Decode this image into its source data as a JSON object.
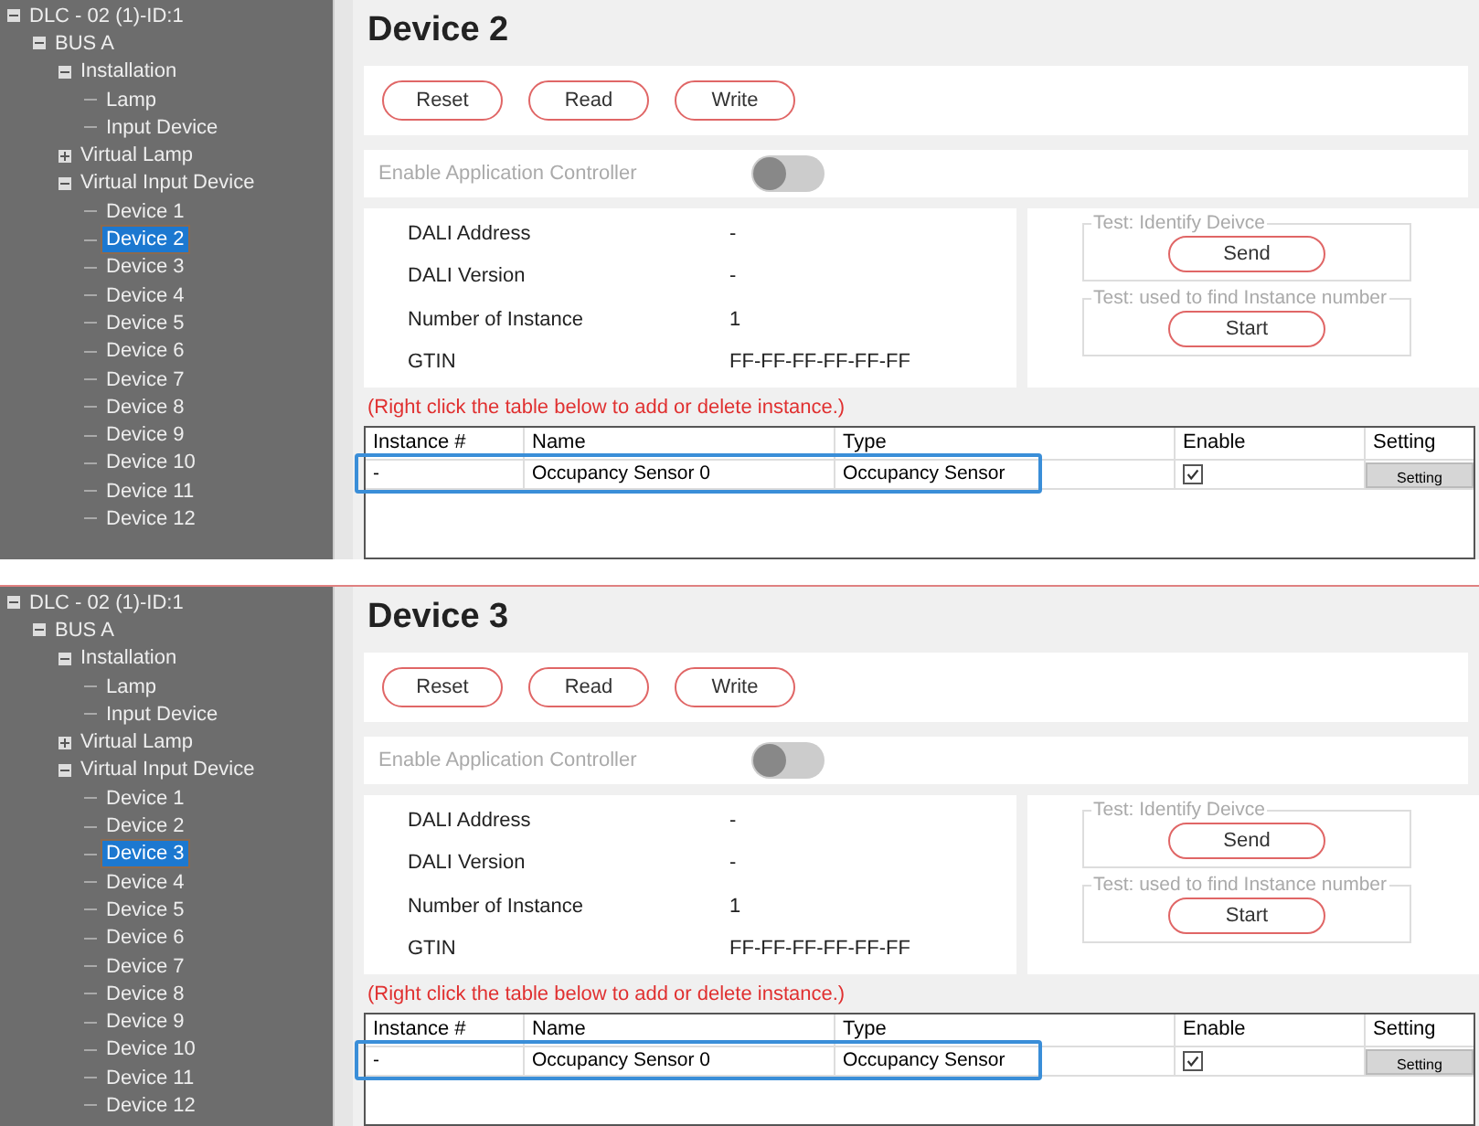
{
  "panels": [
    {
      "tree": [
        {
          "label": "DLC - 02 (1)-ID:1",
          "expanded": true,
          "selected": false,
          "children": [
            {
              "label": "BUS A",
              "expanded": true,
              "selected": false,
              "children": [
                {
                  "label": "Installation",
                  "expanded": true,
                  "selected": false,
                  "children": [
                    {
                      "label": "Lamp",
                      "selected": false
                    },
                    {
                      "label": "Input Device",
                      "selected": false
                    }
                  ]
                },
                {
                  "label": "Virtual Lamp",
                  "expanded": false,
                  "selected": false
                },
                {
                  "label": "Virtual Input Device",
                  "expanded": true,
                  "selected": false,
                  "children": [
                    {
                      "label": "Device 1",
                      "selected": false
                    },
                    {
                      "label": "Device 2",
                      "selected": true
                    },
                    {
                      "label": "Device 3",
                      "selected": false
                    },
                    {
                      "label": "Device 4",
                      "selected": false
                    },
                    {
                      "label": "Device 5",
                      "selected": false
                    },
                    {
                      "label": "Device 6",
                      "selected": false
                    },
                    {
                      "label": "Device 7",
                      "selected": false
                    },
                    {
                      "label": "Device 8",
                      "selected": false
                    },
                    {
                      "label": "Device 9",
                      "selected": false
                    },
                    {
                      "label": "Device 10",
                      "selected": false
                    },
                    {
                      "label": "Device 11",
                      "selected": false
                    },
                    {
                      "label": "Device 12",
                      "selected": false
                    }
                  ]
                }
              ]
            }
          ]
        }
      ],
      "title": "Device 2",
      "buttons": [
        "Reset",
        "Read",
        "Write"
      ],
      "enable_controller": {
        "label": "Enable Application Controller",
        "on": false
      },
      "info": [
        {
          "label": "DALI Address",
          "value": "-"
        },
        {
          "label": "DALI Version",
          "value": "-"
        },
        {
          "label": "Number of Instance",
          "value": "1"
        },
        {
          "label": "GTIN",
          "value": "FF-FF-FF-FF-FF-FF"
        }
      ],
      "tests": [
        {
          "legend": "Test: Identify Deivce",
          "button": "Send"
        },
        {
          "legend": "Test: used to find Instance number",
          "button": "Start"
        }
      ],
      "note": "(Right click the table below to add or delete instance.)",
      "table": {
        "columns": [
          "Instance #",
          "Name",
          "Type",
          "Enable",
          "Setting"
        ],
        "rows": [
          {
            "instance": "-",
            "name": "Occupancy Sensor 0",
            "type": "Occupancy Sensor",
            "enabled": true,
            "setting": "Setting",
            "highlighted": true
          }
        ]
      }
    },
    {
      "tree": [
        {
          "label": "DLC - 02 (1)-ID:1",
          "expanded": true,
          "selected": false,
          "children": [
            {
              "label": "BUS A",
              "expanded": true,
              "selected": false,
              "children": [
                {
                  "label": "Installation",
                  "expanded": true,
                  "selected": false,
                  "children": [
                    {
                      "label": "Lamp",
                      "selected": false
                    },
                    {
                      "label": "Input Device",
                      "selected": false
                    }
                  ]
                },
                {
                  "label": "Virtual Lamp",
                  "expanded": false,
                  "selected": false
                },
                {
                  "label": "Virtual Input Device",
                  "expanded": true,
                  "selected": false,
                  "children": [
                    {
                      "label": "Device 1",
                      "selected": false
                    },
                    {
                      "label": "Device 2",
                      "selected": false
                    },
                    {
                      "label": "Device 3",
                      "selected": true
                    },
                    {
                      "label": "Device 4",
                      "selected": false
                    },
                    {
                      "label": "Device 5",
                      "selected": false
                    },
                    {
                      "label": "Device 6",
                      "selected": false
                    },
                    {
                      "label": "Device 7",
                      "selected": false
                    },
                    {
                      "label": "Device 8",
                      "selected": false
                    },
                    {
                      "label": "Device 9",
                      "selected": false
                    },
                    {
                      "label": "Device 10",
                      "selected": false
                    },
                    {
                      "label": "Device 11",
                      "selected": false
                    },
                    {
                      "label": "Device 12",
                      "selected": false
                    }
                  ]
                }
              ]
            }
          ]
        }
      ],
      "title": "Device 3",
      "buttons": [
        "Reset",
        "Read",
        "Write"
      ],
      "enable_controller": {
        "label": "Enable Application Controller",
        "on": false
      },
      "info": [
        {
          "label": "DALI Address",
          "value": "-"
        },
        {
          "label": "DALI Version",
          "value": "-"
        },
        {
          "label": "Number of Instance",
          "value": "1"
        },
        {
          "label": "GTIN",
          "value": "FF-FF-FF-FF-FF-FF"
        }
      ],
      "tests": [
        {
          "legend": "Test: Identify Deivce",
          "button": "Send"
        },
        {
          "legend": "Test: used to find Instance number",
          "button": "Start"
        }
      ],
      "note": "(Right click the table below to add or delete instance.)",
      "table": {
        "columns": [
          "Instance #",
          "Name",
          "Type",
          "Enable",
          "Setting"
        ],
        "rows": [
          {
            "instance": "-",
            "name": "Occupancy Sensor 0",
            "type": "Occupancy Sensor",
            "enabled": true,
            "setting": "Setting",
            "highlighted": true
          }
        ]
      }
    }
  ]
}
